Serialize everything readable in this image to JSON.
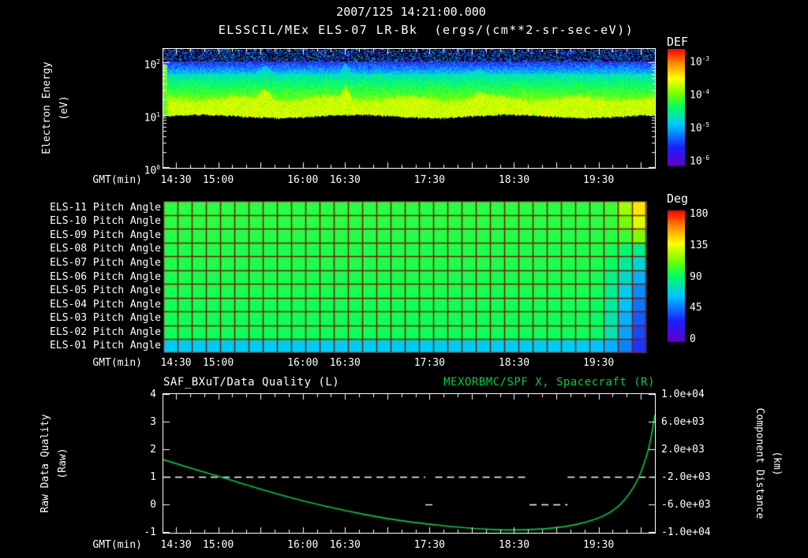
{
  "header": {
    "title": "2007/125 14:21:00.000",
    "subtitle": "ELSSCIL/MEx ELS-07 LR-Bk  (ergs/(cm**2-sr-sec-eV))"
  },
  "colors": {
    "background": "#000000",
    "foreground": "#ffffff",
    "trace_green": "#00cc44",
    "pitch_grid": "#7a1a00"
  },
  "time_axis": {
    "label": "GMT(min)",
    "start": "14:21",
    "end": "20:10",
    "span_min": 349,
    "major_tick_start": "14:30",
    "major_tick_step_min": 30,
    "labeled_ticks": [
      "14:30",
      "15:00",
      "16:00",
      "16:30",
      "17:30",
      "18:30",
      "19:30"
    ]
  },
  "spectrogram_panel": {
    "colorbar_title": "DEF",
    "colorbar_tick_exponents": [
      -3,
      -4,
      -5,
      -6
    ],
    "y_label_line1": "Electron Energy",
    "y_label_line2": "(eV)",
    "y_tick_exponents": [
      2,
      1,
      0
    ]
  },
  "pitch_panel": {
    "colorbar_title": "Deg",
    "colorbar_ticks": [
      "180",
      "135",
      "90",
      "45",
      "0"
    ],
    "row_labels": [
      "ELS-11 Pitch Angle",
      "ELS-10 Pitch Angle",
      "ELS-09 Pitch Angle",
      "ELS-08 Pitch Angle",
      "ELS-07 Pitch Angle",
      "ELS-06 Pitch Angle",
      "ELS-05 Pitch Angle",
      "ELS-04 Pitch Angle",
      "ELS-03 Pitch Angle",
      "ELS-02 Pitch Angle",
      "ELS-01 Pitch Angle"
    ]
  },
  "line_panel": {
    "left_title": "SAF_BXuT/Data Quality (L)",
    "right_title": "MEXORBMC/SPF X, Spacecraft (R)",
    "left_ticks": [
      "4",
      "3",
      "2",
      "1",
      "0",
      "-1"
    ],
    "right_ticks": [
      "1.0e+04",
      "6.0e+03",
      "2.0e+03",
      "-2.0e+03",
      "-6.0e+03",
      "-1.0e+04"
    ],
    "left_label_line1": "Raw Data Quality",
    "left_label_line2": "(Raw)",
    "right_label_line1": "Component Distance",
    "right_label_line2": "(km)"
  },
  "chart_data": [
    {
      "type": "spectrogram",
      "name": "electron-differential-energy-flux",
      "title": "ELSSCIL/MEx ELS-07 LR-Bk",
      "units": "ergs/(cm**2-sr-sec-eV)",
      "x": {
        "label": "GMT(min)",
        "start": "14:21",
        "end": "20:10"
      },
      "y": {
        "label": "Electron Energy (eV)",
        "scale": "log",
        "range_ev": [
          1,
          178
        ],
        "ticks_ev": [
          1,
          10,
          100
        ]
      },
      "colorbar": {
        "label": "DEF",
        "scale": "log",
        "range": [
          1e-06,
          0.001
        ],
        "ticks": [
          0.001,
          0.0001,
          1e-05,
          1e-06
        ]
      },
      "features": [
        {
          "desc": "black, below detection",
          "log10_e": [
            0,
            0.98
          ],
          "log10_flux": null
        },
        {
          "desc": "intense quasi-continuous band ~10-21 eV",
          "log10_e": [
            0.98,
            1.32
          ],
          "log10_flux": -3.95,
          "noise": 0.25
        },
        {
          "desc": "declining flux green to cyan ~21-60 eV",
          "log10_e": [
            1.32,
            1.78
          ],
          "log10_flux_bottom": -4.25,
          "log10_flux_top": -4.85,
          "noise": 0.25
        },
        {
          "desc": "weak flux cyan-blue-violet ~60-105 eV",
          "log10_e": [
            1.78,
            2.02
          ],
          "log10_flux_bottom": -5.0,
          "log10_flux_top": -5.7,
          "noise": 0.35
        },
        {
          "desc": "sparse violet speckle above ~105 eV",
          "log10_e": [
            2.02,
            2.25
          ],
          "log10_flux": -5.5,
          "fill_fraction": 0.45
        },
        {
          "desc": "bright stripe at data start",
          "t_min_range": [
            0,
            3
          ],
          "log10_flux": -4.3
        }
      ],
      "band_bumps": [
        {
          "t": "15:33",
          "width_min": 7,
          "extra_log_e": 0.18
        },
        {
          "t": "16:30",
          "width_min": 5,
          "extra_log_e": 0.22
        },
        {
          "t": "18:05",
          "width_min": 9,
          "extra_log_e": 0.1
        }
      ]
    },
    {
      "type": "heatmap",
      "name": "pitch-angle-by-anode",
      "units": "Deg",
      "colorbar": {
        "label": "Deg",
        "range": [
          0,
          180
        ],
        "ticks": [
          180,
          135,
          90,
          45,
          0
        ]
      },
      "columns": 34,
      "rows": [
        {
          "name": "ELS-11",
          "base_deg": 97,
          "tail_deg": [
            97,
            100,
            118,
            140
          ]
        },
        {
          "name": "ELS-10",
          "base_deg": 97,
          "tail_deg": [
            97,
            98,
            110,
            128
          ]
        },
        {
          "name": "ELS-09",
          "base_deg": 96,
          "tail_deg": [
            96,
            96,
            100,
            112
          ]
        },
        {
          "name": "ELS-08",
          "base_deg": 95,
          "tail_deg": [
            95,
            93,
            88,
            84
          ]
        },
        {
          "name": "ELS-07",
          "base_deg": 95,
          "tail_deg": [
            94,
            90,
            80,
            70
          ]
        },
        {
          "name": "ELS-06",
          "base_deg": 94,
          "tail_deg": [
            93,
            85,
            72,
            58
          ]
        },
        {
          "name": "ELS-05",
          "base_deg": 94,
          "tail_deg": [
            92,
            82,
            66,
            50
          ]
        },
        {
          "name": "ELS-04",
          "base_deg": 93,
          "tail_deg": [
            91,
            80,
            62,
            45
          ]
        },
        {
          "name": "ELS-03",
          "base_deg": 93,
          "tail_deg": [
            90,
            78,
            58,
            40
          ]
        },
        {
          "name": "ELS-02",
          "base_deg": 92,
          "tail_deg": [
            89,
            76,
            55,
            36
          ]
        },
        {
          "name": "ELS-01",
          "base_deg": 65,
          "tail_deg": [
            62,
            58,
            48,
            32
          ]
        }
      ]
    },
    {
      "type": "line",
      "name": "data-quality-and-spacecraft-x",
      "left_axis": {
        "title": "SAF_BXuT/Data Quality (L)",
        "label": "Raw Data Quality (Raw)",
        "range": [
          -1,
          4
        ]
      },
      "right_axis": {
        "title": "MEXORBMC/SPF X, Spacecraft (R)",
        "label": "Component Distance (km)",
        "range": [
          -10000,
          10000
        ]
      },
      "series": [
        {
          "name": "SAF_BXuT/Data Quality (L)",
          "axis": "left",
          "color": "#ffffff",
          "linestyle": "dashed",
          "segments": [
            {
              "t0": "14:21",
              "t1": "17:27",
              "value": 1
            },
            {
              "t0": "17:27",
              "t1": "17:34",
              "value": 0
            },
            {
              "t0": "17:34",
              "t1": "18:41",
              "value": 1
            },
            {
              "t0": "18:41",
              "t1": "19:08",
              "value": 0
            },
            {
              "t0": "19:08",
              "t1": "20:10",
              "value": 1
            }
          ]
        },
        {
          "name": "MEXORBMC/SPF X, Spacecraft (R)",
          "axis": "right",
          "color": "#00cc44",
          "linestyle": "solid",
          "points": [
            {
              "t": "14:21",
              "km": 500
            },
            {
              "t": "14:41",
              "km": -800
            },
            {
              "t": "15:00",
              "km": -1900
            },
            {
              "t": "15:30",
              "km": -3800
            },
            {
              "t": "16:00",
              "km": -5500
            },
            {
              "t": "16:30",
              "km": -6900
            },
            {
              "t": "17:00",
              "km": -8100
            },
            {
              "t": "17:30",
              "km": -8900
            },
            {
              "t": "18:00",
              "km": -9500
            },
            {
              "t": "18:30",
              "km": -9780
            },
            {
              "t": "19:00",
              "km": -9450
            },
            {
              "t": "19:20",
              "km": -8700
            },
            {
              "t": "19:35",
              "km": -7600
            },
            {
              "t": "19:45",
              "km": -6200
            },
            {
              "t": "19:53",
              "km": -4200
            },
            {
              "t": "19:59",
              "km": -2000
            },
            {
              "t": "20:04",
              "km": 900
            },
            {
              "t": "20:07",
              "km": 3300
            },
            {
              "t": "20:10",
              "km": 7000
            }
          ]
        }
      ]
    }
  ]
}
